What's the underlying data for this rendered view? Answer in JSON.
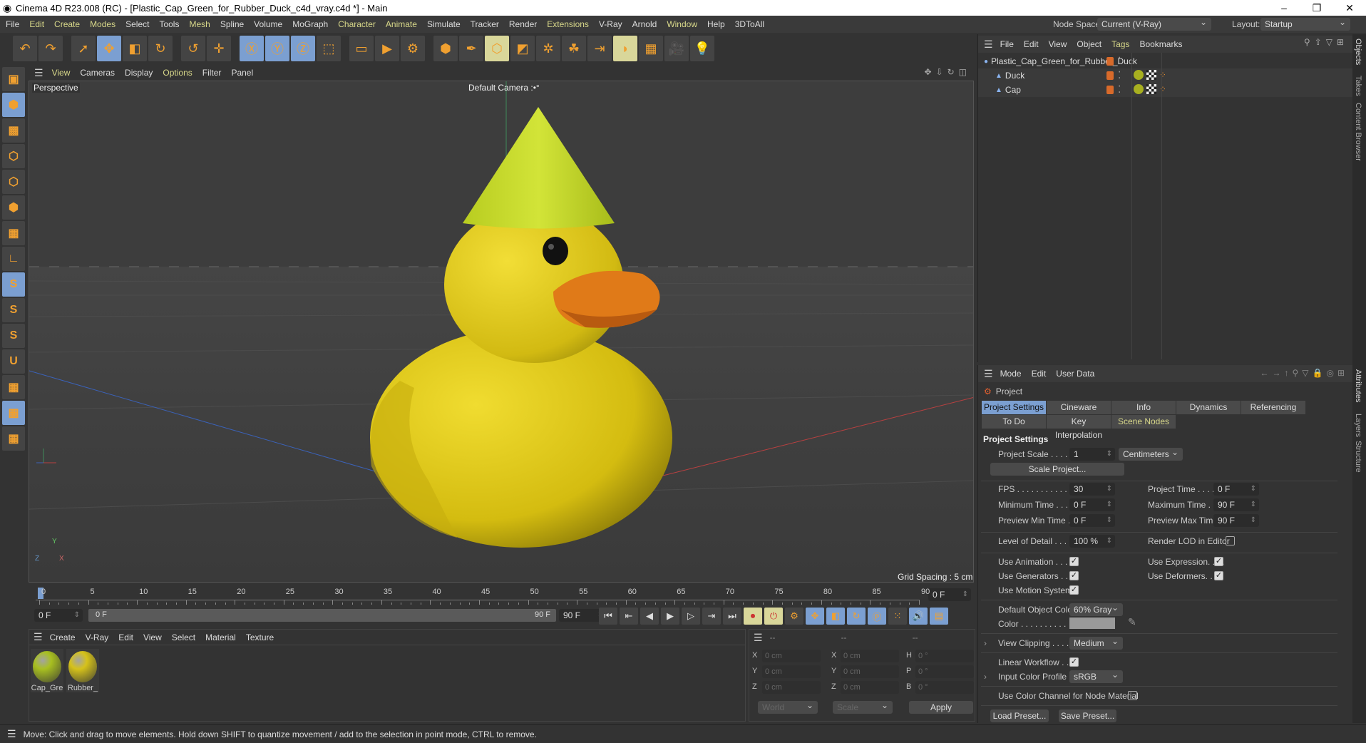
{
  "window": {
    "title": "Cinema 4D R23.008 (RC) - [Plastic_Cap_Green_for_Rubber_Duck_c4d_vray.c4d *] - Main",
    "minimize": "–",
    "restore": "❐",
    "close": "✕"
  },
  "menu": [
    {
      "label": "File"
    },
    {
      "label": "Edit",
      "hl": true
    },
    {
      "label": "Create",
      "hl": true
    },
    {
      "label": "Modes",
      "hl": true
    },
    {
      "label": "Select"
    },
    {
      "label": "Tools"
    },
    {
      "label": "Mesh",
      "hl": true
    },
    {
      "label": "Spline"
    },
    {
      "label": "Volume"
    },
    {
      "label": "MoGraph"
    },
    {
      "label": "Character",
      "hl": true
    },
    {
      "label": "Animate",
      "hl": true
    },
    {
      "label": "Simulate"
    },
    {
      "label": "Tracker"
    },
    {
      "label": "Render"
    },
    {
      "label": "Extensions",
      "hl": true
    },
    {
      "label": "V-Ray"
    },
    {
      "label": "Arnold"
    },
    {
      "label": "Window",
      "hl": true
    },
    {
      "label": "Help"
    },
    {
      "label": "3DToAll"
    }
  ],
  "node_space": {
    "label": "Node Space:",
    "value": "Current (V-Ray)"
  },
  "layout": {
    "label": "Layout:",
    "value": "Startup"
  },
  "toolbar": [
    {
      "icon": "undo-icon",
      "g": "↶"
    },
    {
      "icon": "redo-icon",
      "g": "↷"
    },
    {
      "sep": true
    },
    {
      "icon": "select-icon",
      "g": "➚"
    },
    {
      "icon": "move-icon",
      "g": "✥",
      "on": true
    },
    {
      "icon": "scale-icon",
      "g": "◧"
    },
    {
      "icon": "rotate-icon",
      "g": "↻"
    },
    {
      "sep": true
    },
    {
      "icon": "psr-icon",
      "g": "↺"
    },
    {
      "icon": "add-icon",
      "g": "✛"
    },
    {
      "sep": true
    },
    {
      "icon": "x-axis-icon",
      "g": "Ⓧ",
      "on": true
    },
    {
      "icon": "y-axis-icon",
      "g": "Ⓨ",
      "on": true
    },
    {
      "icon": "z-axis-icon",
      "g": "Ⓩ",
      "on": true
    },
    {
      "icon": "coordinate-system-icon",
      "g": "⬚"
    },
    {
      "sep": true
    },
    {
      "icon": "render-region-icon",
      "g": "▭"
    },
    {
      "icon": "render-view-icon",
      "g": "▶"
    },
    {
      "icon": "render-settings-icon",
      "g": "⚙"
    },
    {
      "sep": true
    },
    {
      "icon": "cube-icon",
      "g": "⬢"
    },
    {
      "icon": "pen-icon",
      "g": "✒"
    },
    {
      "icon": "subdivision-icon",
      "g": "⬡",
      "y": true
    },
    {
      "icon": "extrude-icon",
      "g": "◩"
    },
    {
      "icon": "cloner-icon",
      "g": "✲"
    },
    {
      "icon": "mograph-icon",
      "g": "☘"
    },
    {
      "icon": "deformer-icon",
      "g": "⇥"
    },
    {
      "icon": "bend-icon",
      "g": "◗",
      "y": true
    },
    {
      "icon": "floor-icon",
      "g": "▦"
    },
    {
      "icon": "camera-icon",
      "g": "🎥"
    },
    {
      "icon": "light-icon",
      "g": "💡"
    }
  ],
  "left_tools": [
    {
      "icon": "model-mode-icon",
      "g": "▣"
    },
    {
      "icon": "object-mode-icon",
      "g": "⬢",
      "on": true
    },
    {
      "icon": "texture-mode-icon",
      "g": "▩"
    },
    {
      "icon": "point-mode-icon",
      "g": "⬡"
    },
    {
      "icon": "edge-mode-icon",
      "g": "⬡"
    },
    {
      "icon": "polygon-mode-icon",
      "g": "⬢"
    },
    {
      "icon": "uv-mode-icon",
      "g": "▦"
    },
    {
      "icon": "axis-mode-icon",
      "g": "∟"
    },
    {
      "icon": "snap-icon",
      "g": "S",
      "on": true
    },
    {
      "icon": "snap-settings-icon",
      "g": "S"
    },
    {
      "icon": "snap-enable-icon",
      "g": "S"
    },
    {
      "icon": "magnet-icon",
      "g": "U"
    },
    {
      "icon": "workplane-icon",
      "g": "▦"
    },
    {
      "icon": "lock-workplane-icon",
      "g": "▦",
      "on": true
    },
    {
      "icon": "workplane-align-icon",
      "g": "▦"
    }
  ],
  "viewport_menu": [
    {
      "label": "View",
      "hl": true
    },
    {
      "label": "Cameras"
    },
    {
      "label": "Display"
    },
    {
      "label": "Options",
      "hl": true
    },
    {
      "label": "Filter"
    },
    {
      "label": "Panel"
    }
  ],
  "viewport": {
    "view_name": "Perspective",
    "camera": "Default Camera :•°",
    "grid_spacing": "Grid Spacing : 5 cm",
    "axis_y": "Y",
    "axis_x": "X",
    "axis_z": "Z"
  },
  "objects": {
    "menu": [
      {
        "label": "File"
      },
      {
        "label": "Edit"
      },
      {
        "label": "View"
      },
      {
        "label": "Object"
      },
      {
        "label": "Tags",
        "hl": true
      },
      {
        "label": "Bookmarks"
      }
    ],
    "items": [
      {
        "name": "Plastic_Cap_Green_for_Rubber_Duck",
        "level": 0,
        "tags": false
      },
      {
        "name": "Duck",
        "level": 1,
        "tags": true
      },
      {
        "name": "Cap",
        "level": 1,
        "tags": true
      }
    ]
  },
  "side_tabs": {
    "objects": "Objects",
    "takes": "Takes",
    "content_browser": "Content Browser",
    "attributes": "Attributes",
    "layers": "Layers",
    "structure": "Structure"
  },
  "attributes": {
    "menu": [
      {
        "label": "Mode"
      },
      {
        "label": "Edit"
      },
      {
        "label": "User Data"
      }
    ],
    "object": "Project",
    "tabs1": [
      {
        "label": "Project Settings",
        "on": true
      },
      {
        "label": "Cineware"
      },
      {
        "label": "Info"
      },
      {
        "label": "Dynamics"
      },
      {
        "label": "Referencing"
      }
    ],
    "tabs2": [
      {
        "label": "To Do"
      },
      {
        "label": "Key Interpolation"
      },
      {
        "label": "Scene Nodes",
        "hl": true
      }
    ],
    "section": "Project Settings",
    "project_scale": {
      "label": "Project Scale . . . . .",
      "value": "1",
      "unit": "Centimeters"
    },
    "scale_project": "Scale Project...",
    "fps": {
      "label": "FPS . . . . . . . . . . .",
      "value": "30"
    },
    "project_time": {
      "label": "Project Time . . . . .",
      "value": "0 F"
    },
    "min_time": {
      "label": "Minimum Time . . .",
      "value": "0 F"
    },
    "max_time": {
      "label": "Maximum Time . . .",
      "value": "90 F"
    },
    "preview_min": {
      "label": "Preview Min Time . .",
      "value": "0 F"
    },
    "preview_max": {
      "label": "Preview Max Time .",
      "value": "90 F"
    },
    "lod": {
      "label": "Level of Detail . . . .",
      "value": "100 %"
    },
    "render_lod": {
      "label": "Render LOD in Editor",
      "checked": false
    },
    "use_animation": {
      "label": "Use Animation . . . .",
      "checked": true
    },
    "use_expression": {
      "label": "Use Expression. . . .",
      "checked": true
    },
    "use_generators": {
      "label": "Use Generators . . .",
      "checked": true
    },
    "use_deformers": {
      "label": "Use Deformers. . . .",
      "checked": true
    },
    "use_motion": {
      "label": "Use Motion System",
      "checked": true
    },
    "default_color": {
      "label": "Default Object Color",
      "value": "60% Gray"
    },
    "color": {
      "label": "Color . . . . . . . . . .",
      "swatch": "#9a9a9a"
    },
    "view_clipping": {
      "label": "View Clipping . . . .",
      "value": "Medium"
    },
    "linear_workflow": {
      "label": "Linear Workflow . . .",
      "checked": true
    },
    "input_profile": {
      "label": "Input Color Profile .",
      "value": "sRGB"
    },
    "use_color_channel": {
      "label": "Use Color Channel for Node Material",
      "checked": false
    },
    "load_preset": "Load Preset...",
    "save_preset": "Save Preset..."
  },
  "timeline": {
    "ticks": [
      "0",
      "5",
      "10",
      "15",
      "20",
      "25",
      "30",
      "35",
      "40",
      "45",
      "50",
      "55",
      "60",
      "65",
      "70",
      "75",
      "80",
      "85",
      "90"
    ],
    "current": 0,
    "end_field": "0 F"
  },
  "transport": {
    "start": "0 F",
    "range_start": "0 F",
    "range_end": "90 F",
    "end": "90 F"
  },
  "materials": {
    "menu": [
      {
        "label": "Create"
      },
      {
        "label": "V-Ray"
      },
      {
        "label": "Edit"
      },
      {
        "label": "View"
      },
      {
        "label": "Select"
      },
      {
        "label": "Material"
      },
      {
        "label": "Texture"
      }
    ],
    "items": [
      {
        "name": "Cap_Gre",
        "color": "#a8c020"
      },
      {
        "name": "Rubber_",
        "color": "#d6c21a"
      }
    ]
  },
  "coords": {
    "headers": [
      "--",
      "--",
      "--"
    ],
    "rows": [
      {
        "a": "X",
        "av": "0 cm",
        "b": "X",
        "bv": "0 cm",
        "c": "H",
        "cv": "0 °"
      },
      {
        "a": "Y",
        "av": "0 cm",
        "b": "Y",
        "bv": "0 cm",
        "c": "P",
        "cv": "0 °"
      },
      {
        "a": "Z",
        "av": "0 cm",
        "b": "Z",
        "bv": "0 cm",
        "c": "B",
        "cv": "0 °"
      }
    ],
    "space": "World",
    "mode": "Scale",
    "apply": "Apply"
  },
  "status": "Move: Click and drag to move elements. Hold down SHIFT to quantize movement / add to the selection in point mode, CTRL to remove.",
  "colors": {
    "accent": "#7b9fd1",
    "highlight_text": "#d8d88a",
    "duck": "#d8c21a",
    "cap": "#c4d82a",
    "beak": "#e07a18"
  }
}
